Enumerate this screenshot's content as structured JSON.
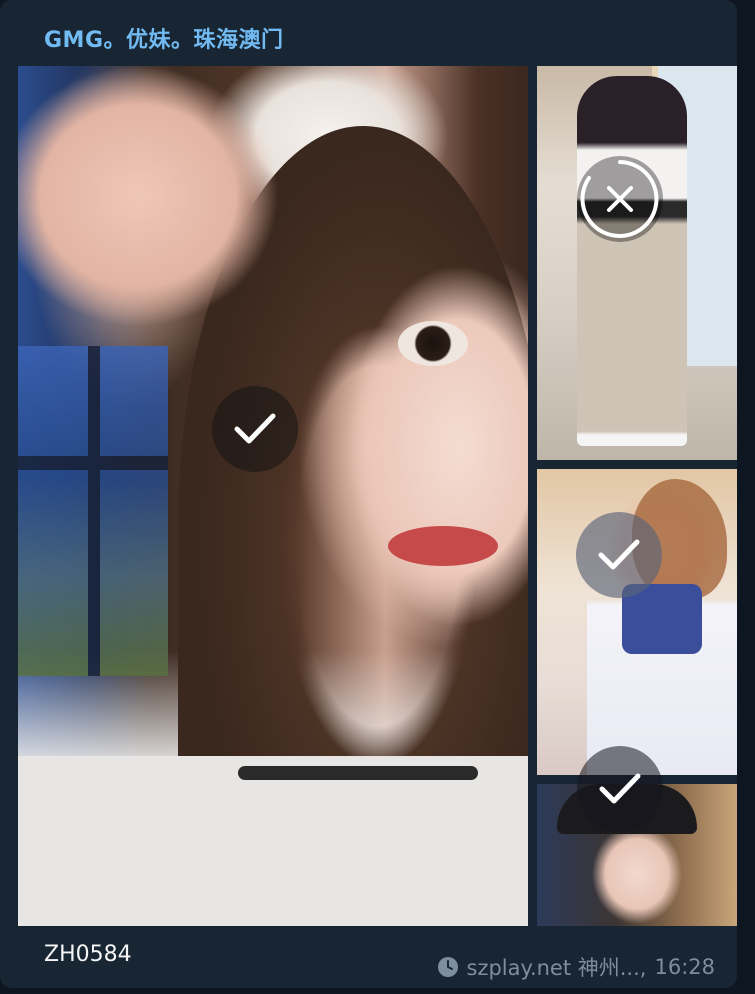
{
  "message": {
    "sender": "GMG。优妹。珠海澳门",
    "caption": "ZH0584",
    "footer": {
      "source": "szplay.net 神州...,",
      "time": "16:28"
    }
  },
  "album": {
    "photos": [
      {
        "name": "photo-main",
        "selection": "checked",
        "icon": "check-icon"
      },
      {
        "name": "photo-top-right",
        "selection": "loading",
        "icon": "close-icon"
      },
      {
        "name": "photo-mid-right",
        "selection": "checked",
        "icon": "check-icon"
      },
      {
        "name": "photo-bottom-right",
        "selection": "checked",
        "icon": "check-icon"
      }
    ]
  },
  "colors": {
    "background": "#0e1621",
    "bubble": "#182533",
    "sender": "#71baf2",
    "meta": "#7d8e9e",
    "caption": "#f5f5f5"
  }
}
